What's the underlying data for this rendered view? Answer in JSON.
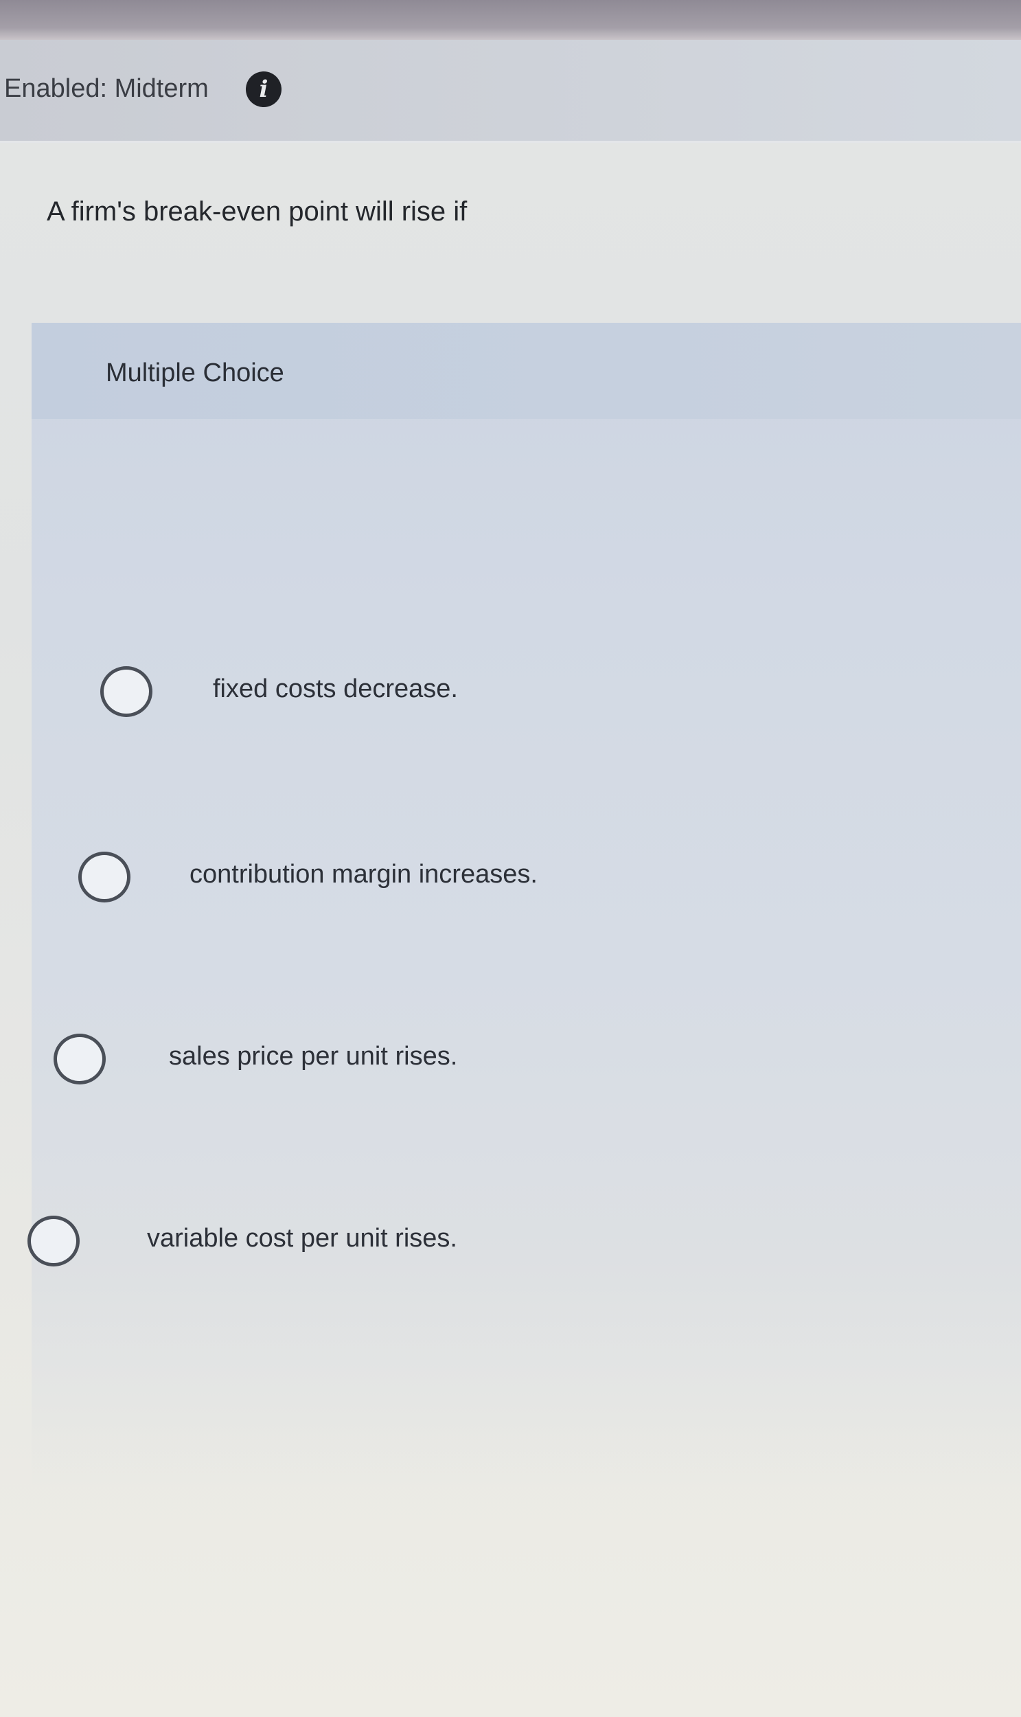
{
  "header": {
    "title": "Enabled: Midterm",
    "info_icon": "info-icon"
  },
  "question": {
    "text": "A firm's break-even point will rise if"
  },
  "answer_panel": {
    "type_label": "Multiple Choice",
    "options": [
      {
        "label": "fixed costs decrease."
      },
      {
        "label": "contribution margin increases."
      },
      {
        "label": "sales price per unit rises."
      },
      {
        "label": "variable cost per unit rises."
      }
    ]
  },
  "colors": {
    "header_background": "#cfd3da",
    "panel_background": "#d2d9e4",
    "radio_border": "#4a4f58",
    "info_icon_background": "#1f2126"
  }
}
